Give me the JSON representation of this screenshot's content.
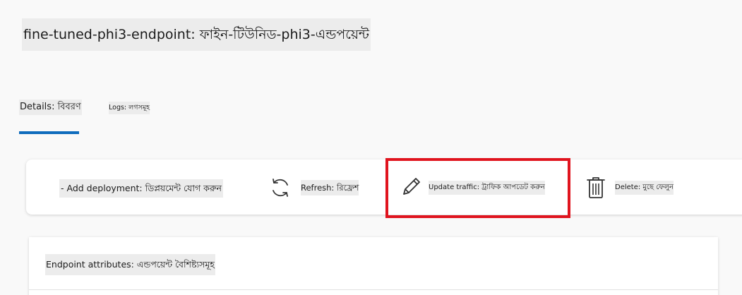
{
  "page": {
    "title": "fine-tuned-phi3-endpoint: ফাইন-টিউনিড-phi3-এন্ডপয়েন্ট"
  },
  "tabs": [
    {
      "label": "Details: বিবরণ",
      "selected": true
    },
    {
      "label": "Logs: লগসমূহ",
      "selected": false
    }
  ],
  "toolbar": {
    "add_deployment_label": "- Add deployment: ডিপ্লয়মেন্ট যোগ করুন",
    "refresh_label": "Refresh: রিফ্রেশ",
    "update_traffic_label": "Update traffic: ট্রাফিক আপডেট করুন",
    "delete_label": "Delete: মুছে ফেলুন",
    "icons": {
      "refresh": "refresh-icon",
      "update_traffic": "pencil-icon",
      "delete": "trash-icon"
    }
  },
  "attributes": {
    "title": "Endpoint attributes: এন্ডপয়েন্ট বৈশিষ্ট্যসমূহ"
  },
  "colors": {
    "accent": "#0f6cbd",
    "highlight": "#e0141e",
    "background": "#f9f9f9"
  }
}
